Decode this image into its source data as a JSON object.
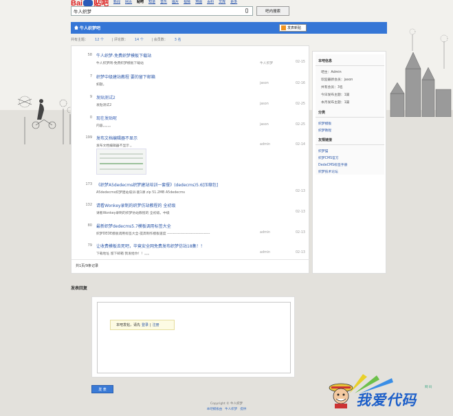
{
  "baidu": {
    "logo": "Bai",
    "logo_suffix": "贴吧",
    "nav": [
      "新闻",
      "网页",
      "贴吧",
      "知道",
      "音乐",
      "图片",
      "视频",
      "地图",
      "百科",
      "文库",
      "更多"
    ],
    "current_nav_index": 2,
    "search_value": "牛人织梦",
    "search_button": "吧内搜索"
  },
  "forum": {
    "title": "牛人织梦吧",
    "post_button": "发表新贴",
    "stats": {
      "topics_label": "共有主题：",
      "topics_value": "12 个",
      "replies_label": "评论数：",
      "replies_value": "14 个",
      "members_label": "会员数：",
      "members_value": "3 名"
    }
  },
  "threads": [
    {
      "count": "58",
      "title": "牛人织梦-免费织梦模板下载站",
      "abstract": "牛人织梦网-免费织梦模板下载站",
      "author": "牛人织梦",
      "time": "02-15"
    },
    {
      "count": "7",
      "title": "织梦中级建站教程 要的留下邮箱",
      "abstract": "如题。",
      "author": "jason",
      "time": "02-16"
    },
    {
      "count": "9",
      "title": "发贴测试2",
      "abstract": "发贴测试2",
      "author": "jason",
      "time": "02-25"
    },
    {
      "count": "0",
      "title": "现在发贴呢",
      "abstract": "内容。。。。。",
      "author": "jason",
      "time": "02-25"
    },
    {
      "count": "199",
      "title": "发布文档编辑器不显示",
      "abstract": "发布文档编辑器不显示 。",
      "author": "admin",
      "time": "02-14"
    },
    {
      "count": "173",
      "title": "《织梦A5dedecms织梦建站培训一套餐》(dedecms)5.6[压缩包]",
      "abstract": "A5dedecms织梦建站培训-第1课 zip 51.2MB A5dedecms",
      "author": "",
      "time": "02-13"
    },
    {
      "count": "132",
      "title": "请看Wonkey录制的织梦仿站教程的 全初级",
      "abstract": "请看Wonkey录制的织梦仿站教程的 全初级。中级",
      "author": "",
      "time": "02-13"
    },
    {
      "count": "80",
      "title": "最新织梦dedecms5.7模板调用标签大全",
      "abstract": "织梦DEDE模板调用标签大全-提高制作模板速度 ------------------------------------",
      "author": "admin",
      "time": "02-13"
    },
    {
      "count": "79",
      "title": "让收费模板去死吧，毕竟安全网免费发布织梦仿站18集！！",
      "abstract": "下载地址 留下邮箱 我发给你！！。。。",
      "author": "admin",
      "time": "02-13"
    }
  ],
  "pagination": "共1页/9条记录",
  "sidebar": {
    "info_title": "本吧信息",
    "info_rows": [
      "吧主：Admin",
      "欢迎最新会员：jason",
      "共有会员：3名",
      "今日发布主题：1篇",
      "本月发布主题：1篇"
    ],
    "category_title": "分类",
    "categories": [
      "织梦模板",
      "织梦教程"
    ],
    "links_title": "友情链接",
    "links": [
      "织梦猫",
      "织梦CMS官方",
      "DedeCMS标签手册",
      "织梦技术论坛"
    ]
  },
  "reply": {
    "title": "发表回复",
    "tip_prefix": "本吧发帖，请先",
    "login": "登录",
    "separator": "|",
    "register": "注册",
    "submit": "发 表"
  },
  "footer": {
    "copyright": "Copyright © 牛人织梦",
    "links": [
      "本吧模板由",
      "牛人织梦",
      "提供"
    ]
  },
  "watermark": {
    "text": "我爱代码",
    "small": "网 码"
  },
  "colors": {
    "accent": "#3576d6",
    "link": "#2a56a8",
    "post_button_icon": "#f2931d"
  }
}
